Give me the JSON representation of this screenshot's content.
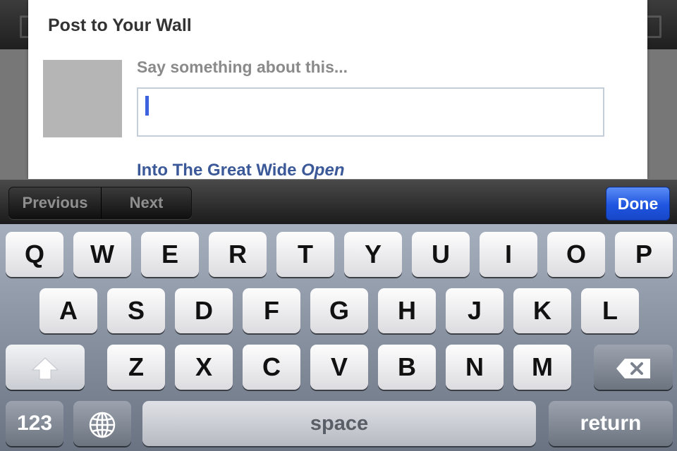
{
  "dialog": {
    "title": "Post to Your Wall",
    "prompt": "Say something about this...",
    "message_value": "",
    "link_title": "Into The Great Wide",
    "link_title_em": "Open"
  },
  "accessory": {
    "previous": "Previous",
    "next": "Next",
    "done": "Done"
  },
  "keyboard": {
    "row1": [
      "Q",
      "W",
      "E",
      "R",
      "T",
      "Y",
      "U",
      "I",
      "O",
      "P"
    ],
    "row2": [
      "A",
      "S",
      "D",
      "F",
      "G",
      "H",
      "J",
      "K",
      "L"
    ],
    "row3": [
      "Z",
      "X",
      "C",
      "V",
      "B",
      "N",
      "M"
    ],
    "numbers": "123",
    "space": "space",
    "return": "return"
  },
  "icons": {
    "shift": "shift-icon",
    "backspace": "backspace-icon",
    "globe": "globe-icon"
  },
  "colors": {
    "done_blue": "#1f55e0",
    "link_blue": "#3b5998",
    "cursor_blue": "#3c62e0"
  }
}
